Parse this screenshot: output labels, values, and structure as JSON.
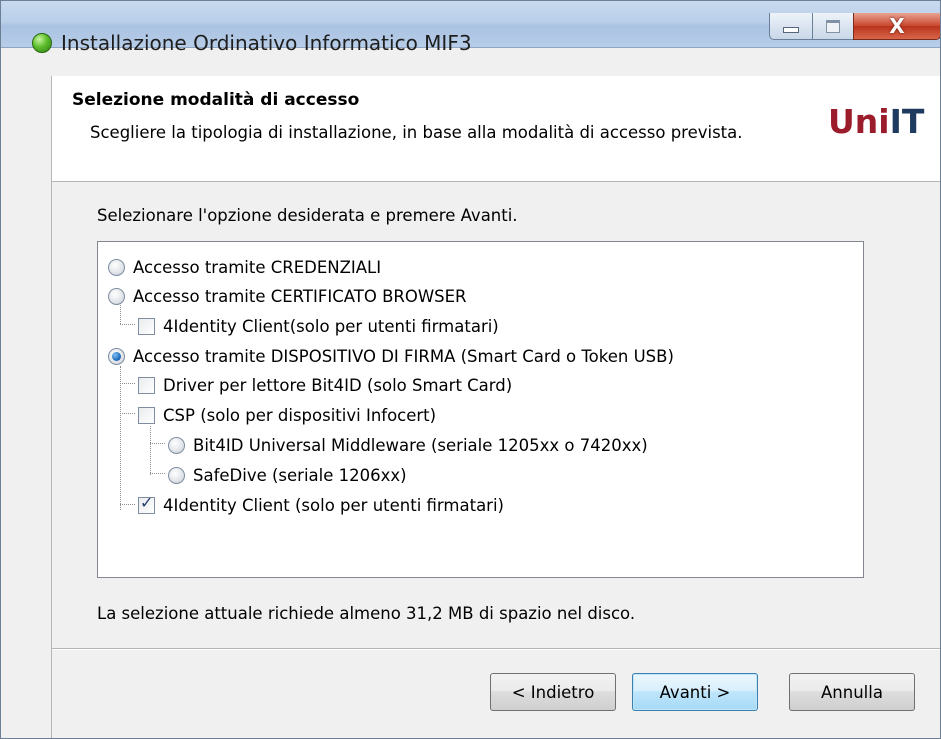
{
  "window": {
    "title": "Installazione Ordinativo Informatico MIF3",
    "close_glyph": "X"
  },
  "header": {
    "title": "Selezione modalità di accesso",
    "subtitle": "Scegliere la tipologia di installazione, in base alla modalità di accesso prevista.",
    "logo_part1": "Uni",
    "logo_part2": "IT"
  },
  "colors": {
    "logo_red": "#9b1c2b",
    "logo_blue": "#1f3a5f",
    "title_bar": "#b9cfe9",
    "primary_button": "#bee6fd"
  },
  "body": {
    "instructions": "Selezionare l'opzione desiderata e premere Avanti.",
    "options": [
      {
        "label": "Accesso tramite CREDENZIALI",
        "control": "radio",
        "checked": false
      },
      {
        "label": "Accesso tramite CERTIFICATO BROWSER",
        "control": "radio",
        "checked": false
      },
      {
        "label": "4Identity Client(solo per utenti firmatari)",
        "control": "checkbox",
        "checked": false
      },
      {
        "label": "Accesso tramite DISPOSITIVO DI FIRMA (Smart Card o Token USB)",
        "control": "radio",
        "checked": true
      },
      {
        "label": "Driver per lettore Bit4ID (solo Smart Card)",
        "control": "checkbox",
        "checked": false
      },
      {
        "label": "CSP (solo per dispositivi Infocert)",
        "control": "checkbox",
        "checked": false
      },
      {
        "label": "Bit4ID Universal Middleware (seriale 1205xx o 7420xx)",
        "control": "radio",
        "checked": false
      },
      {
        "label": "SafeDive (seriale 1206xx)",
        "control": "radio",
        "checked": false
      },
      {
        "label": "4Identity Client (solo per utenti firmatari)",
        "control": "checkbox",
        "checked": true
      }
    ],
    "status": "La selezione attuale richiede almeno 31,2 MB di spazio nel disco."
  },
  "buttons": {
    "back": "< Indietro",
    "next": "Avanti >",
    "cancel": "Annulla"
  }
}
